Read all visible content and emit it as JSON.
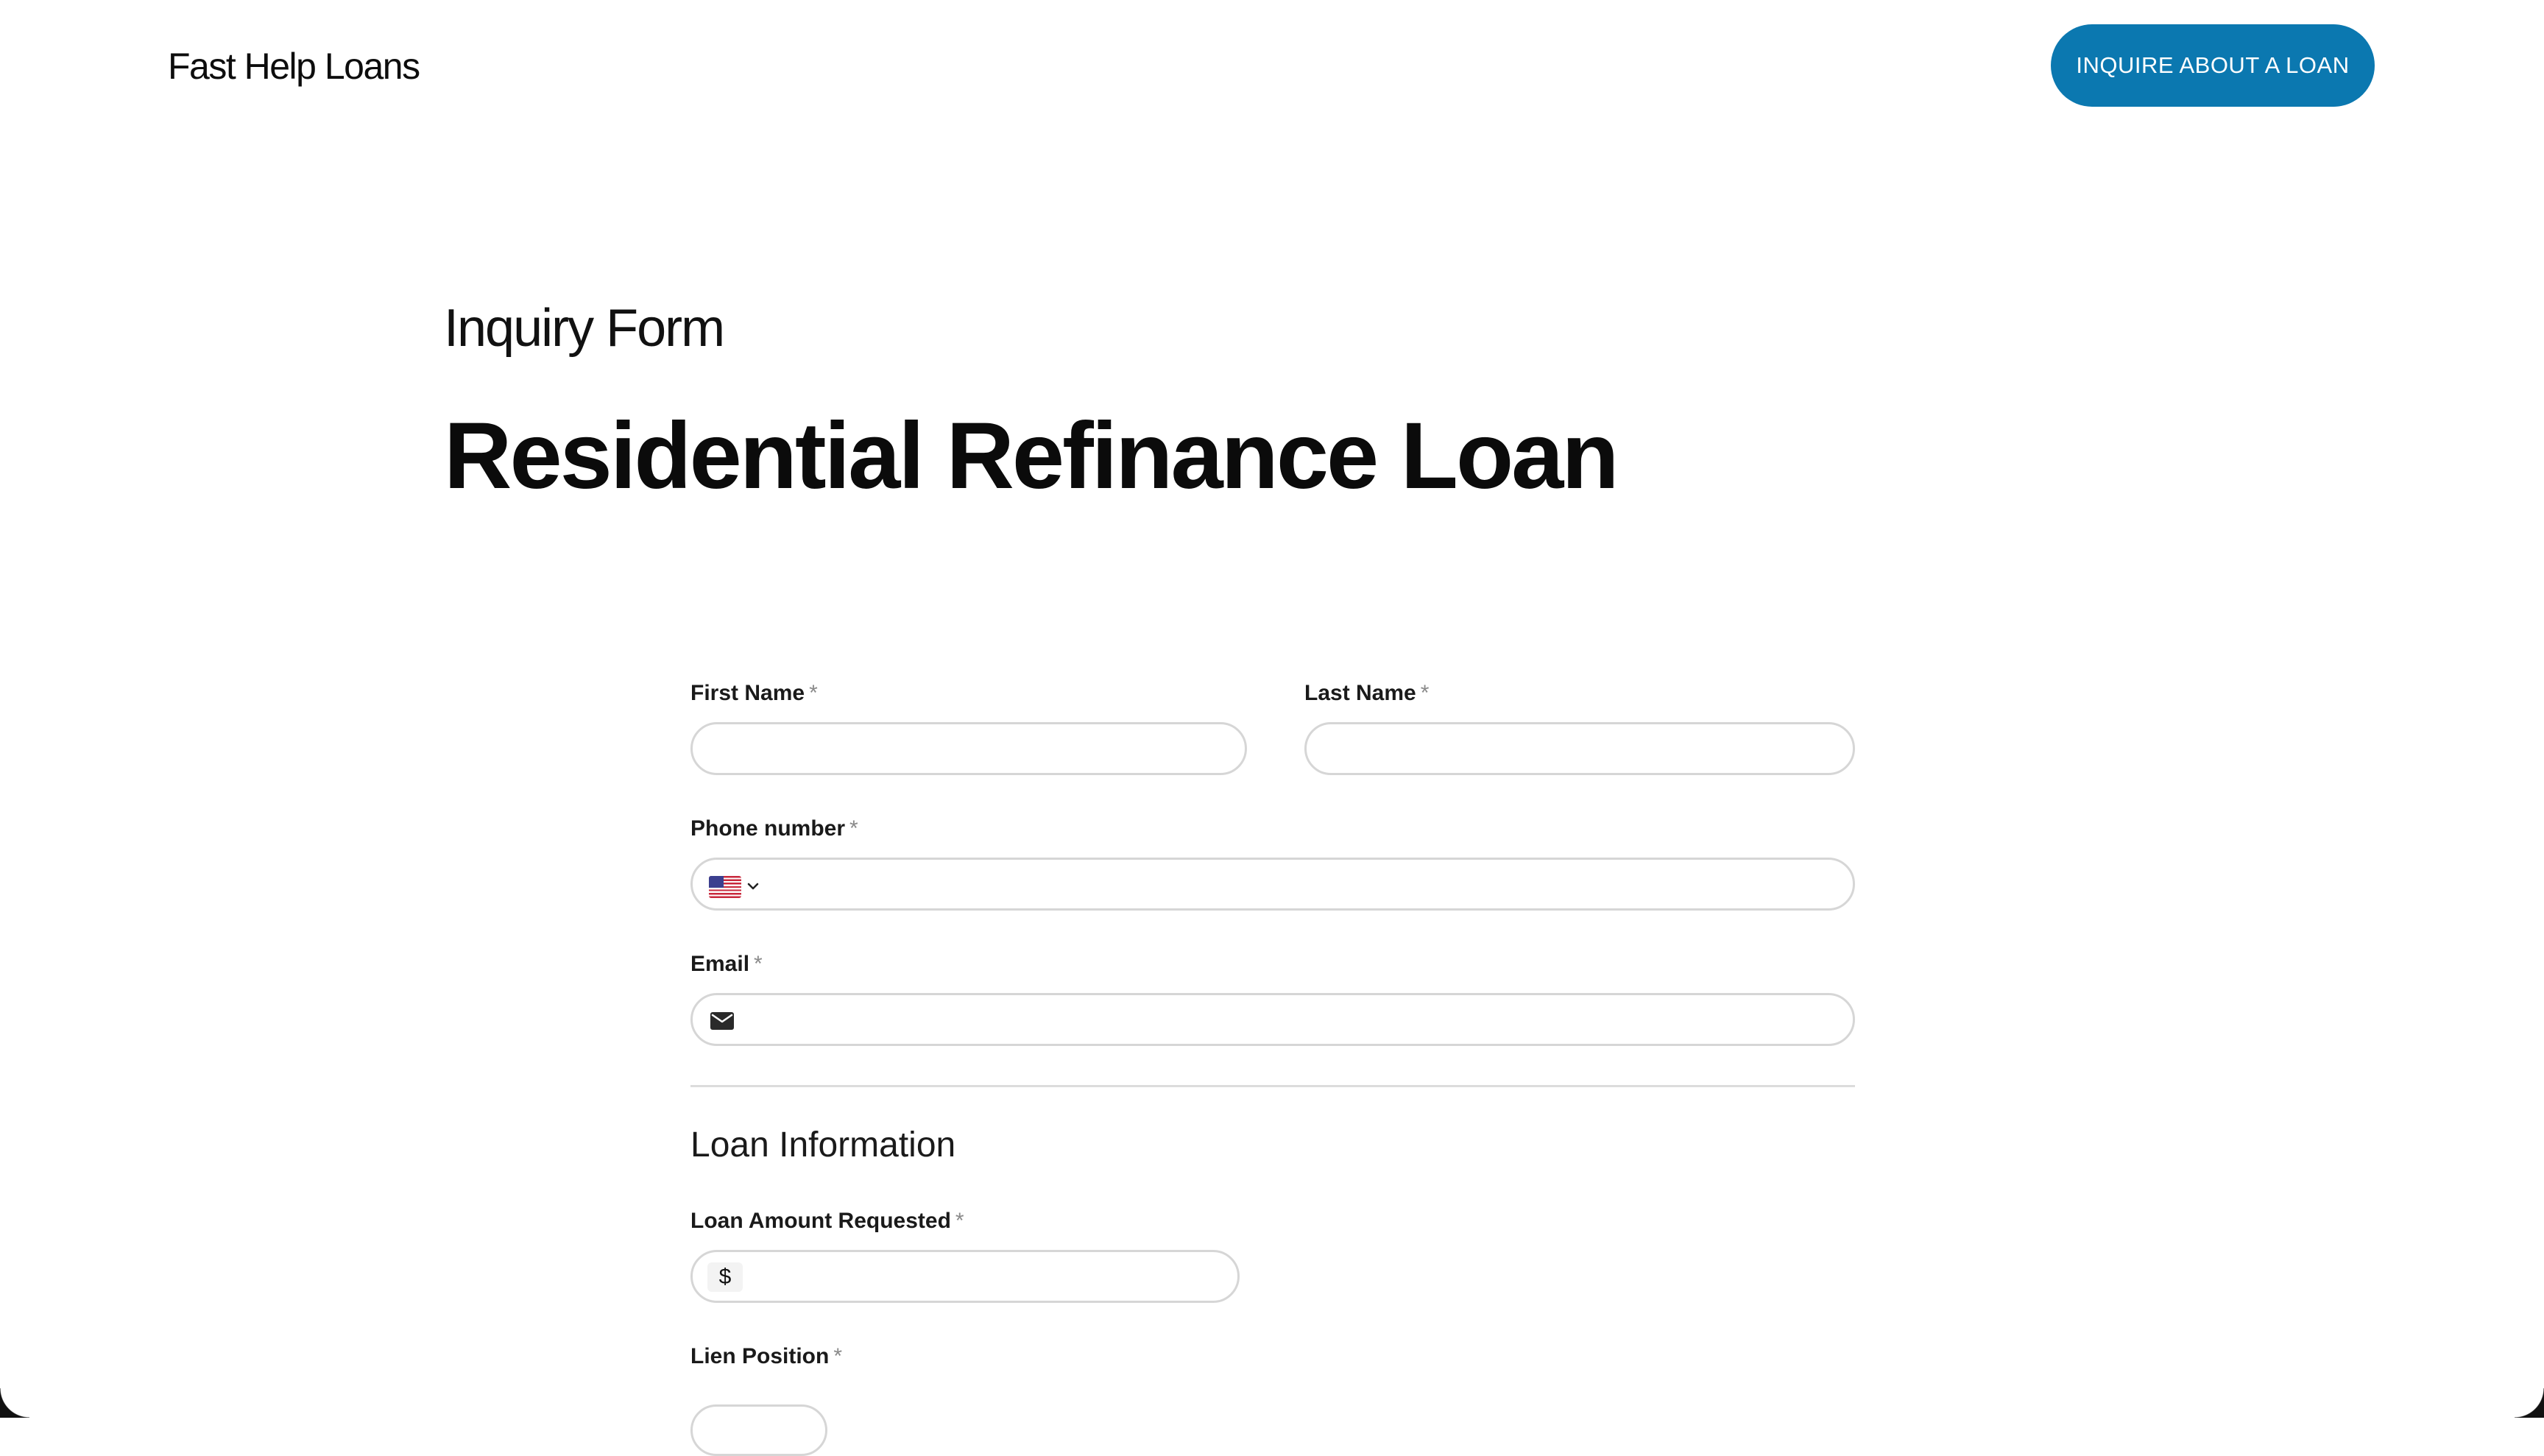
{
  "header": {
    "brand": "Fast Help Loans",
    "cta_label": "INQUIRE ABOUT A LOAN"
  },
  "hero": {
    "eyebrow": "Inquiry Form",
    "title": "Residential Refinance Loan"
  },
  "form": {
    "required_marker": "*",
    "first_name": {
      "label": "First Name",
      "value": ""
    },
    "last_name": {
      "label": "Last Name",
      "value": ""
    },
    "phone": {
      "label": "Phone number",
      "country_flag": "us-flag-icon",
      "value": ""
    },
    "email": {
      "label": "Email",
      "icon": "envelope-icon",
      "value": ""
    },
    "loan_section_title": "Loan Information",
    "loan_amount": {
      "label": "Loan Amount Requested",
      "prefix": "$",
      "value": ""
    },
    "lien_position": {
      "label": "Lien Position"
    }
  },
  "colors": {
    "accent": "#0b78b0",
    "input_border": "#d6d6d6",
    "required_marker": "#8a8a8a"
  }
}
